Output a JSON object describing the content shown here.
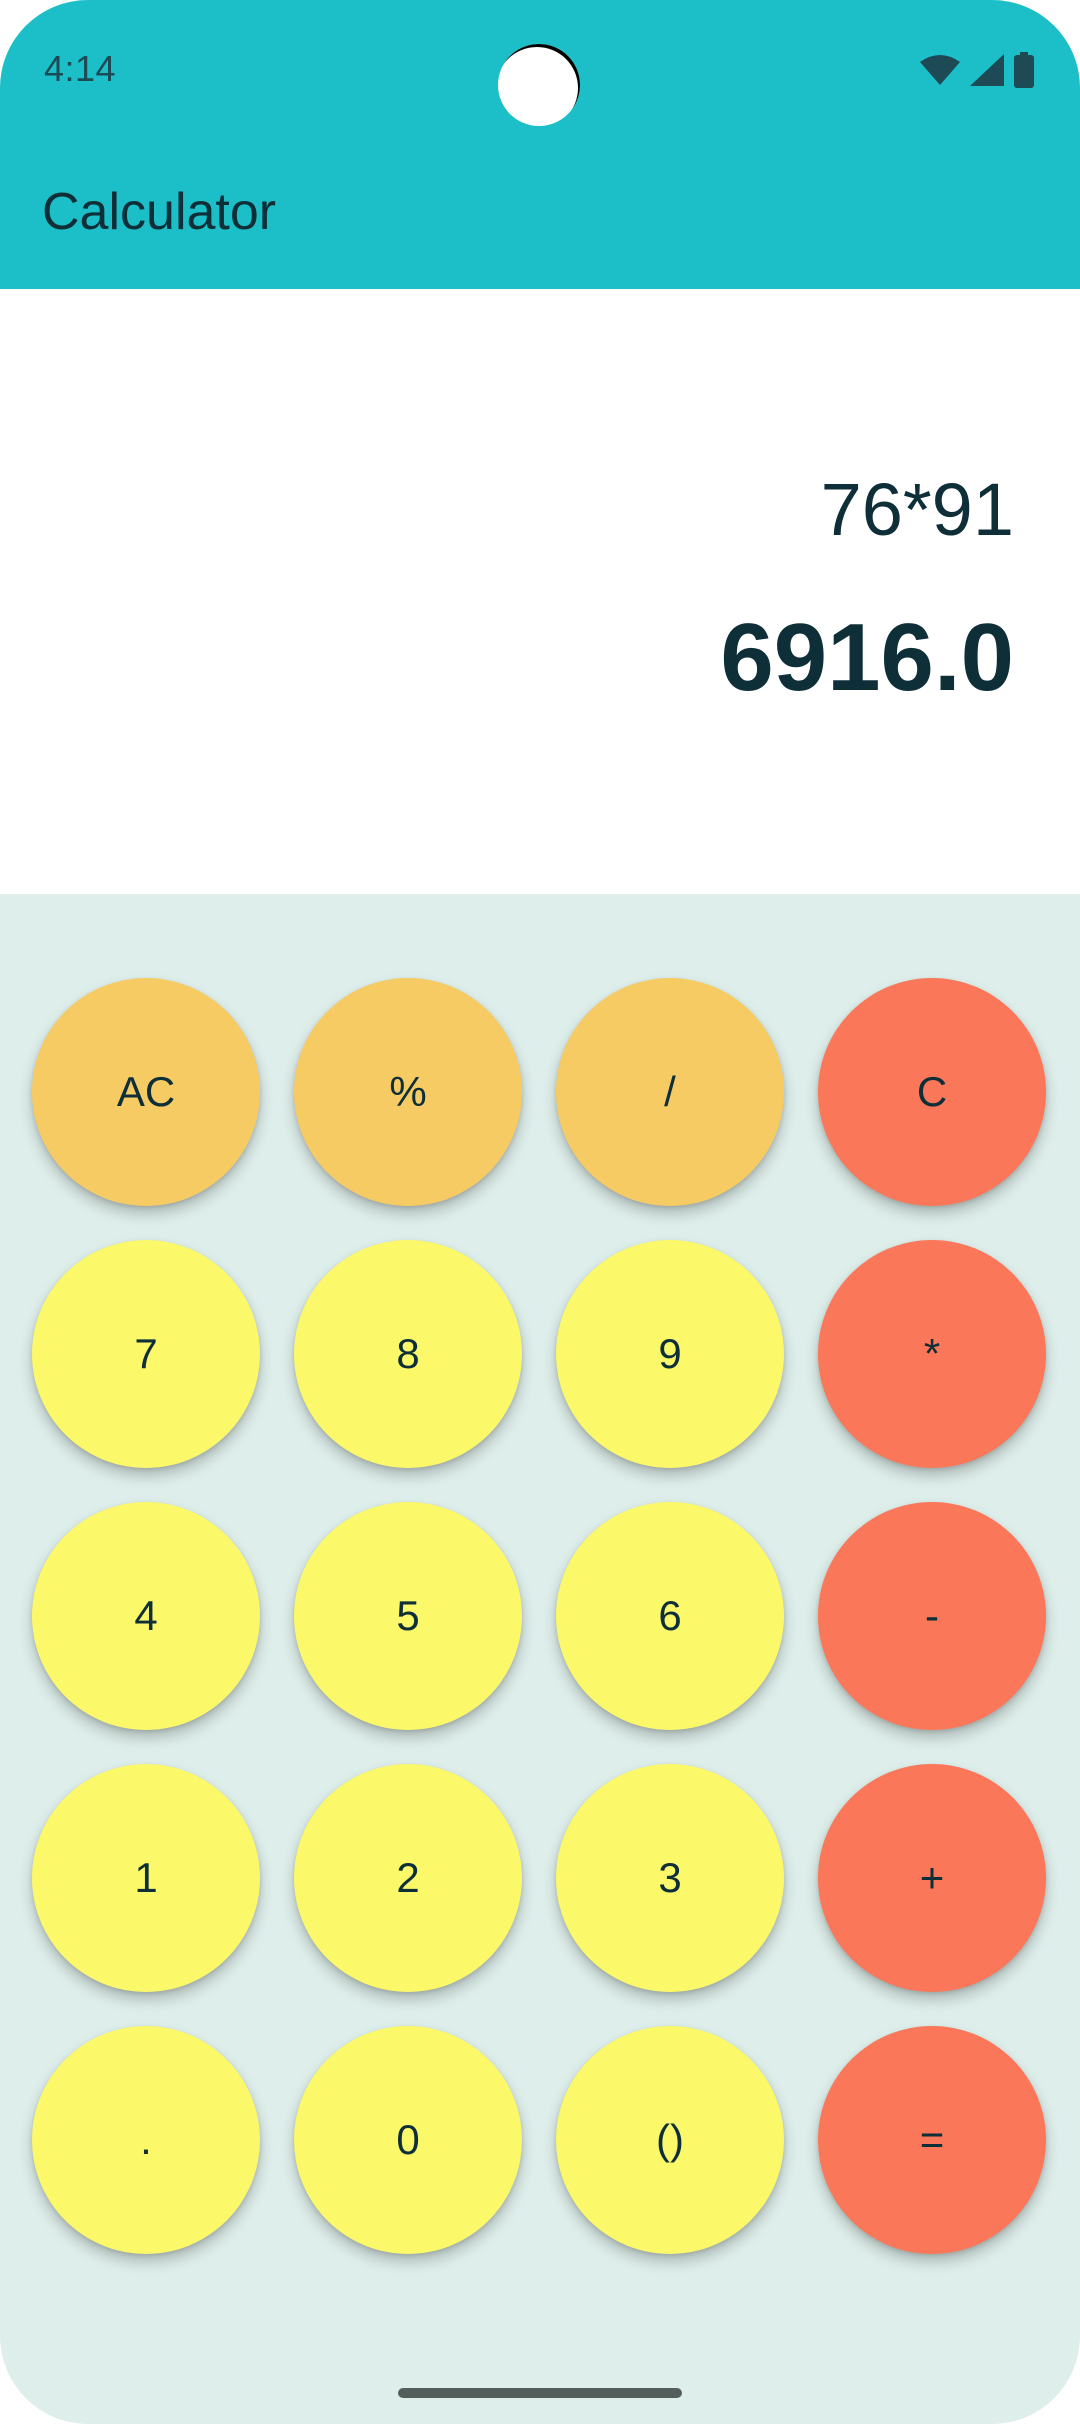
{
  "status_bar": {
    "time": "4:14",
    "icons": [
      "wifi-icon",
      "signal-icon",
      "battery-icon"
    ]
  },
  "app_bar": {
    "title": "Calculator"
  },
  "display": {
    "expression": "76*91",
    "result": "6916.0"
  },
  "keypad": {
    "rows": [
      [
        "AC",
        "%",
        "/",
        "C"
      ],
      [
        "7",
        "8",
        "9",
        "*"
      ],
      [
        "4",
        "5",
        "6",
        "-"
      ],
      [
        "1",
        "2",
        "3",
        "+"
      ],
      [
        ".",
        "0",
        "()",
        "="
      ]
    ]
  },
  "colors": {
    "app_bar": "#1cbfc8",
    "function_key": "#f7cb63",
    "number_key": "#fbf86a",
    "operator_key": "#fa7859",
    "keypad_background": "#deeeea",
    "text": "#0e2e38"
  }
}
